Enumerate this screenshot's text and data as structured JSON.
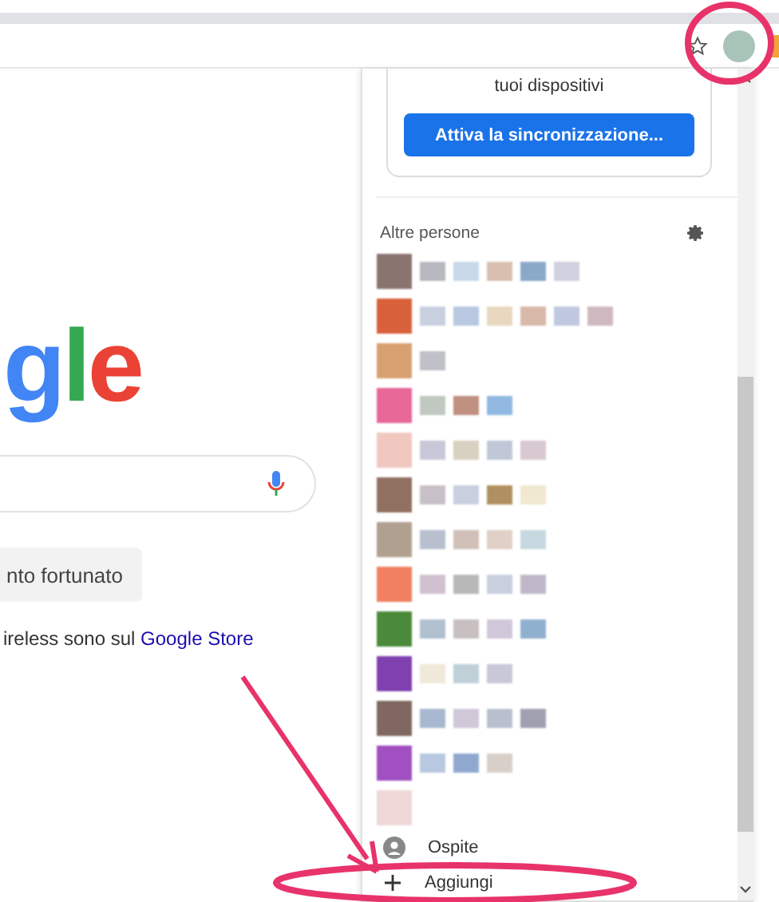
{
  "logo": [
    {
      "letter": "g",
      "color": "#4285f4"
    },
    {
      "letter": "l",
      "color": "#34a853"
    },
    {
      "letter": "e",
      "color": "#ea4335"
    }
  ],
  "lucky_button": "nto fortunato",
  "promo": {
    "text": "ireless sono sul ",
    "link": "Google Store"
  },
  "sync_card": {
    "text": "tuoi dispositivi",
    "button": "Attiva la sincronizzazione..."
  },
  "people": {
    "heading": "Altre persone"
  },
  "guest": "Ospite",
  "add": "Aggiungi"
}
